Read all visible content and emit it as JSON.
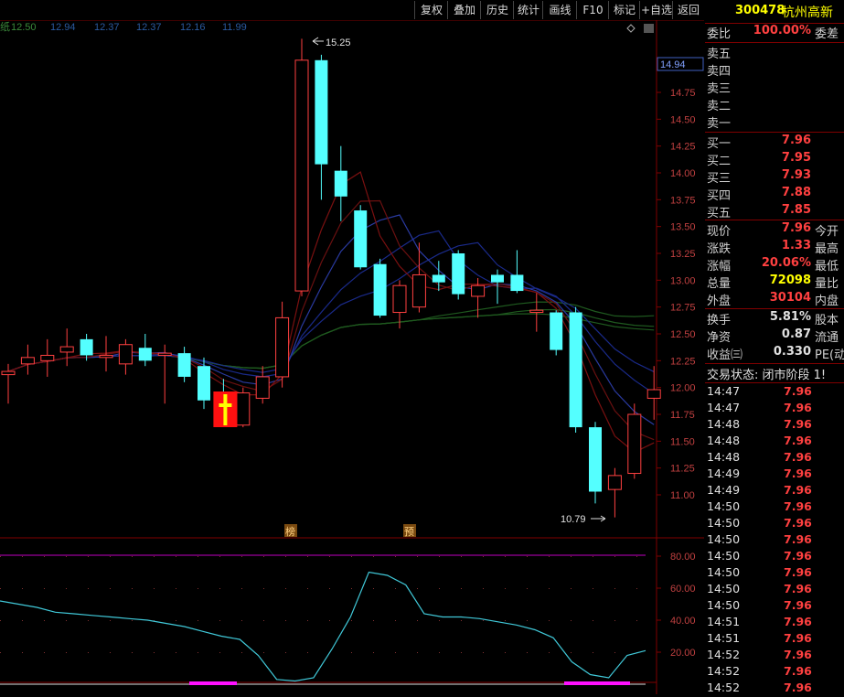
{
  "toolbar": {
    "buttons": [
      "复权",
      "叠加",
      "历史",
      "统计",
      "画线",
      "F10",
      "标记",
      "+自选",
      "返回"
    ]
  },
  "stock": {
    "code": "300478",
    "name": "杭州高新"
  },
  "ma_labels": [
    {
      "text": "12.50",
      "color": "#3a8a3a"
    },
    {
      "text": "12.94",
      "color": "#2a5aa0"
    },
    {
      "text": "12.37",
      "color": "#2a5aa0"
    },
    {
      "text": "12.37",
      "color": "#2a5aa0"
    },
    {
      "text": "12.16",
      "color": "#2a5aa0"
    },
    {
      "text": "11.99",
      "color": "#2a5aa0"
    }
  ],
  "ma_prefix": "纸",
  "price_axis": {
    "current_tag": "14.94",
    "ticks": [
      "14.75",
      "14.50",
      "14.25",
      "14.00",
      "13.75",
      "13.50",
      "13.25",
      "13.00",
      "12.75",
      "12.50",
      "12.25",
      "12.00",
      "11.75",
      "11.50",
      "11.25",
      "11.00"
    ]
  },
  "annotations": {
    "high": "15.25",
    "low": "10.79",
    "marker1": "榜",
    "marker2": "预"
  },
  "indicator_axis": {
    "ticks": [
      "80.00",
      "60.00",
      "40.00",
      "20.00"
    ]
  },
  "chart_data": {
    "type": "candlestick",
    "price_range": [
      10.6,
      15.35
    ],
    "candles": [
      {
        "o": 12.12,
        "h": 12.22,
        "l": 11.85,
        "c": 12.15
      },
      {
        "o": 12.22,
        "h": 12.4,
        "l": 12.12,
        "c": 12.28
      },
      {
        "o": 12.25,
        "h": 12.45,
        "l": 12.1,
        "c": 12.3
      },
      {
        "o": 12.33,
        "h": 12.55,
        "l": 12.2,
        "c": 12.38
      },
      {
        "o": 12.45,
        "h": 12.5,
        "l": 12.25,
        "c": 12.3
      },
      {
        "o": 12.28,
        "h": 12.48,
        "l": 12.15,
        "c": 12.3
      },
      {
        "o": 12.22,
        "h": 12.45,
        "l": 12.12,
        "c": 12.4
      },
      {
        "o": 12.37,
        "h": 12.5,
        "l": 12.2,
        "c": 12.25
      },
      {
        "o": 12.3,
        "h": 12.4,
        "l": 11.85,
        "c": 12.32
      },
      {
        "o": 12.32,
        "h": 12.38,
        "l": 12.05,
        "c": 12.1
      },
      {
        "o": 12.2,
        "h": 12.28,
        "l": 11.8,
        "c": 11.88
      },
      {
        "o": 11.9,
        "h": 12.08,
        "l": 11.78,
        "c": 11.8
      },
      {
        "o": 11.65,
        "h": 12.0,
        "l": 11.63,
        "c": 11.95
      },
      {
        "o": 11.9,
        "h": 12.2,
        "l": 11.85,
        "c": 12.1
      },
      {
        "o": 12.1,
        "h": 12.8,
        "l": 12.0,
        "c": 12.65
      },
      {
        "o": 12.9,
        "h": 15.25,
        "l": 12.85,
        "c": 15.05
      },
      {
        "o": 15.05,
        "h": 15.1,
        "l": 13.75,
        "c": 14.08
      },
      {
        "o": 14.02,
        "h": 14.25,
        "l": 13.55,
        "c": 13.78
      },
      {
        "o": 13.65,
        "h": 13.7,
        "l": 13.1,
        "c": 13.12
      },
      {
        "o": 13.15,
        "h": 13.2,
        "l": 12.65,
        "c": 12.67
      },
      {
        "o": 12.7,
        "h": 13.0,
        "l": 12.55,
        "c": 12.95
      },
      {
        "o": 12.75,
        "h": 13.35,
        "l": 12.7,
        "c": 13.05
      },
      {
        "o": 13.05,
        "h": 13.18,
        "l": 12.9,
        "c": 12.98
      },
      {
        "o": 13.25,
        "h": 13.28,
        "l": 12.82,
        "c": 12.87
      },
      {
        "o": 12.85,
        "h": 13.02,
        "l": 12.65,
        "c": 12.95
      },
      {
        "o": 13.05,
        "h": 13.1,
        "l": 12.78,
        "c": 12.98
      },
      {
        "o": 13.05,
        "h": 13.28,
        "l": 12.88,
        "c": 12.9
      },
      {
        "o": 12.7,
        "h": 12.88,
        "l": 12.52,
        "c": 12.72
      },
      {
        "o": 12.7,
        "h": 12.72,
        "l": 12.3,
        "c": 12.35
      },
      {
        "o": 12.7,
        "h": 12.75,
        "l": 11.58,
        "c": 11.63
      },
      {
        "o": 11.63,
        "h": 11.68,
        "l": 10.92,
        "c": 11.03
      },
      {
        "o": 11.05,
        "h": 11.25,
        "l": 10.79,
        "c": 11.18
      },
      {
        "o": 11.2,
        "h": 11.85,
        "l": 11.15,
        "c": 11.75
      },
      {
        "o": 11.9,
        "h": 12.2,
        "l": 11.7,
        "c": 11.98
      }
    ],
    "indicator": [
      52,
      50,
      48,
      45,
      44,
      43,
      42,
      41,
      40,
      38,
      36,
      33,
      30,
      28,
      18,
      3,
      2,
      4,
      22,
      42,
      70,
      68,
      62,
      44,
      42,
      42,
      41,
      39,
      37,
      34,
      29,
      14,
      6,
      4,
      18,
      21
    ],
    "indicator_range": [
      0,
      100
    ]
  },
  "panel": {
    "weibi": {
      "label": "委比",
      "value": "100.00%",
      "label2": "委差"
    },
    "sell": [
      {
        "label": "卖五",
        "value": ""
      },
      {
        "label": "卖四",
        "value": ""
      },
      {
        "label": "卖三",
        "value": ""
      },
      {
        "label": "卖二",
        "value": ""
      },
      {
        "label": "卖一",
        "value": ""
      }
    ],
    "buy": [
      {
        "label": "买一",
        "value": "7.96"
      },
      {
        "label": "买二",
        "value": "7.95"
      },
      {
        "label": "买三",
        "value": "7.93"
      },
      {
        "label": "买四",
        "value": "7.88"
      },
      {
        "label": "买五",
        "value": "7.85"
      }
    ],
    "stats": [
      {
        "label": "现价",
        "value": "7.96",
        "color": "#ff4040",
        "label2": "今开"
      },
      {
        "label": "涨跌",
        "value": "1.33",
        "color": "#ff4040",
        "label2": "最高"
      },
      {
        "label": "涨幅",
        "value": "20.06%",
        "color": "#ff4040",
        "label2": "最低"
      },
      {
        "label": "总量",
        "value": "72098",
        "color": "#ffff00",
        "label2": "量比"
      },
      {
        "label": "外盘",
        "value": "30104",
        "color": "#ff4040",
        "label2": "内盘"
      }
    ],
    "stats2": [
      {
        "label": "换手",
        "value": "5.81%",
        "color": "#e0e0e0",
        "label2": "股本"
      },
      {
        "label": "净资",
        "value": "0.87",
        "color": "#e0e0e0",
        "label2": "流通"
      },
      {
        "label": "收益㈢",
        "value": "0.330",
        "color": "#e0e0e0",
        "label2": "PE(动"
      }
    ],
    "status": "交易状态: 闭市阶段 1!",
    "ticks": [
      {
        "time": "14:47",
        "price": "7.96"
      },
      {
        "time": "14:47",
        "price": "7.96"
      },
      {
        "time": "14:48",
        "price": "7.96"
      },
      {
        "time": "14:48",
        "price": "7.96"
      },
      {
        "time": "14:48",
        "price": "7.96"
      },
      {
        "time": "14:49",
        "price": "7.96"
      },
      {
        "time": "14:49",
        "price": "7.96"
      },
      {
        "time": "14:50",
        "price": "7.96"
      },
      {
        "time": "14:50",
        "price": "7.96"
      },
      {
        "time": "14:50",
        "price": "7.96"
      },
      {
        "time": "14:50",
        "price": "7.96"
      },
      {
        "time": "14:50",
        "price": "7.96"
      },
      {
        "time": "14:50",
        "price": "7.96"
      },
      {
        "time": "14:50",
        "price": "7.96"
      },
      {
        "time": "14:51",
        "price": "7.96"
      },
      {
        "time": "14:51",
        "price": "7.96"
      },
      {
        "time": "14:52",
        "price": "7.96"
      },
      {
        "time": "14:52",
        "price": "7.96"
      },
      {
        "time": "14:52",
        "price": "7.96"
      }
    ]
  }
}
